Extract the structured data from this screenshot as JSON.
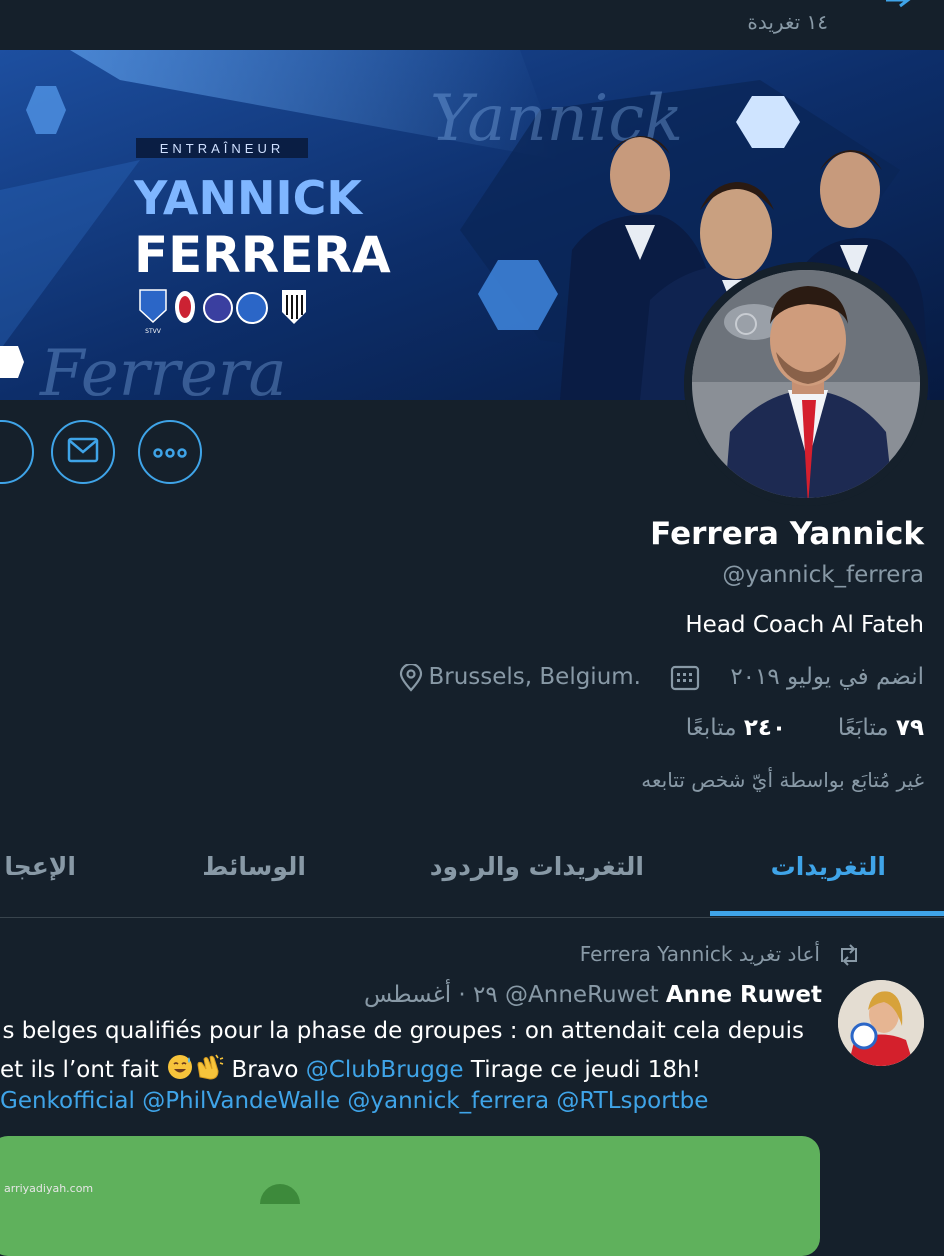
{
  "header": {
    "tweet_count": "١٤ تغريدة",
    "back_icon": "arrow-icon"
  },
  "banner": {
    "label": "ENTRAÎNEUR",
    "first_name": "YANNICK",
    "last_name": "FERRERA",
    "script_text_1": "Yannick",
    "script_text_2": "Ferrera",
    "crest_text": "STVV"
  },
  "actions": {
    "message_icon": "envelope-icon",
    "more_icon": "more-icon"
  },
  "profile": {
    "name": "Ferrera Yannick",
    "handle": "@yannick_ferrera",
    "bio": "Head Coach Al Fateh",
    "location": "Brussels, Belgium.",
    "joined": "انضم في يوليو ٢٠١٩",
    "following_count": "٧٩",
    "following_label": "متابَعًا",
    "followers_count": "٢٤٠",
    "followers_label": "متابعًا",
    "followed_by": "غير مُتابَع بواسطة أيّ شخص تتابعه"
  },
  "tabs": [
    {
      "label": "التغريدات",
      "active": true
    },
    {
      "label": "التغريدات والردود",
      "active": false
    },
    {
      "label": "الوسائط",
      "active": false
    },
    {
      "label": "الإعجا",
      "active": false
    }
  ],
  "tweet": {
    "retweeted_by": "Ferrera Yannick أعاد تغريد",
    "author_name": "Anne Ruwet",
    "author_handle": "@AnneRuwet",
    "date": "٢٩ · أغسطس",
    "line1": "s belges qualifiés pour la phase de groupes : on attendait cela depuis",
    "line2_a": " et ils l’ont fait",
    "line2_b": " Bravo ",
    "line2_link": "@ClubBrugge",
    "line2_c": " Tirage ce jeudi 18h!",
    "line3": "Genkofficial @PhilVandeWalle @yannick_ferrera @RTLsportbe"
  },
  "watermark": "arriyadiyah.com",
  "colors": {
    "background": "#15202b",
    "accent": "#3fa4e8",
    "muted": "#8899a6",
    "banner": "#0c2a5c"
  }
}
